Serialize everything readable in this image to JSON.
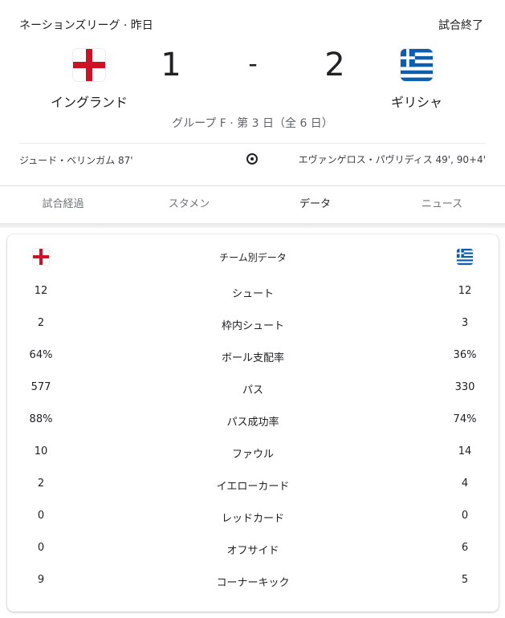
{
  "header": {
    "league": "ネーションズリーグ · 昨日",
    "status": "試合終了",
    "group": "グループ F · 第 3 日（全 6 日）"
  },
  "home": {
    "name": "イングランド",
    "score": "1",
    "scorers": "ジュード・ベリンガム 87'"
  },
  "away": {
    "name": "ギリシャ",
    "score": "2",
    "scorers": "エヴァンゲロス・パヴリディス 49', 90+4'"
  },
  "score_separator": "-",
  "tabs": [
    {
      "label": "試合経過"
    },
    {
      "label": "スタメン"
    },
    {
      "label": "データ"
    },
    {
      "label": "ニュース"
    }
  ],
  "active_tab": "データ",
  "stats": {
    "title": "チーム別データ",
    "rows": [
      {
        "home": "12",
        "label": "シュート",
        "away": "12"
      },
      {
        "home": "2",
        "label": "枠内シュート",
        "away": "3"
      },
      {
        "home": "64%",
        "label": "ボール支配率",
        "away": "36%"
      },
      {
        "home": "577",
        "label": "パス",
        "away": "330"
      },
      {
        "home": "88%",
        "label": "パス成功率",
        "away": "74%"
      },
      {
        "home": "10",
        "label": "ファウル",
        "away": "14"
      },
      {
        "home": "2",
        "label": "イエローカード",
        "away": "4"
      },
      {
        "home": "0",
        "label": "レッドカード",
        "away": "0"
      },
      {
        "home": "0",
        "label": "オフサイド",
        "away": "6"
      },
      {
        "home": "9",
        "label": "コーナーキック",
        "away": "5"
      }
    ]
  },
  "icons": {
    "home_flag": "england-flag-icon",
    "away_flag": "greece-flag-icon",
    "goal": "soccer-ball-icon"
  },
  "colors": {
    "england_red": "#ce1124",
    "greece_blue": "#0d5eaf",
    "active_tab_text": "#202124",
    "inactive_tab_text": "#70757a"
  }
}
